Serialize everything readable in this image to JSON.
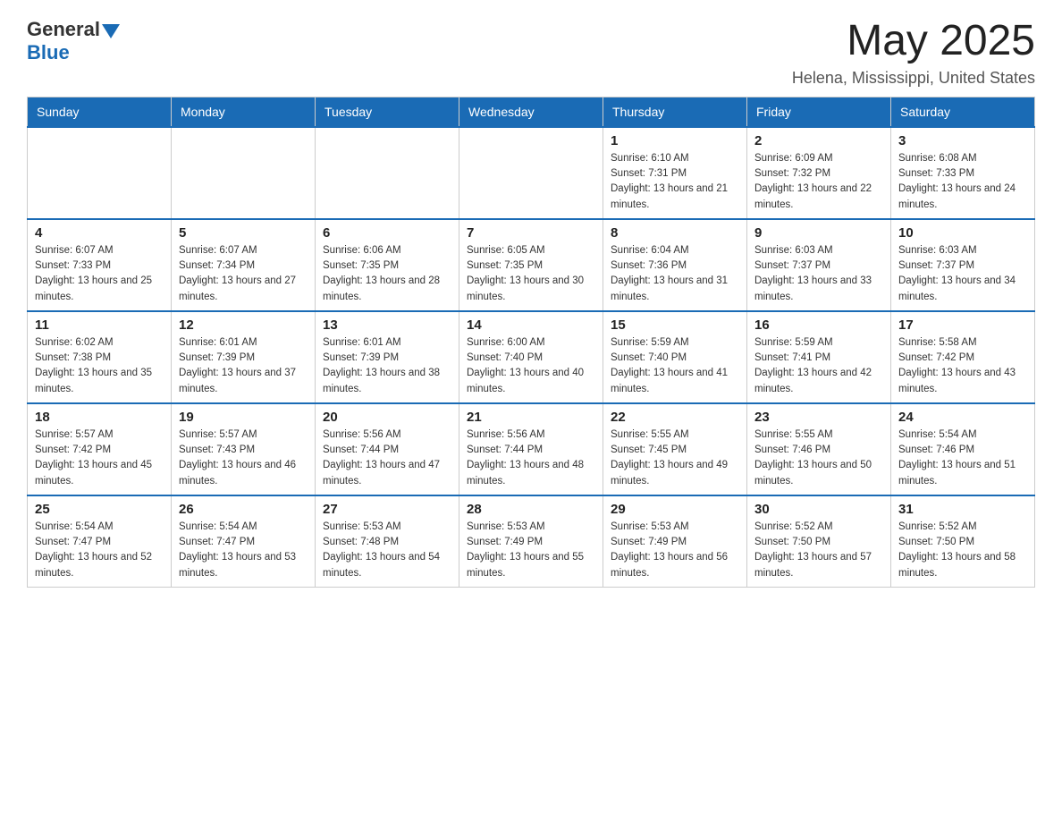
{
  "header": {
    "logo_general": "General",
    "logo_blue": "Blue",
    "month_year": "May 2025",
    "location": "Helena, Mississippi, United States"
  },
  "days_of_week": [
    "Sunday",
    "Monday",
    "Tuesday",
    "Wednesday",
    "Thursday",
    "Friday",
    "Saturday"
  ],
  "weeks": [
    [
      {
        "day": "",
        "info": ""
      },
      {
        "day": "",
        "info": ""
      },
      {
        "day": "",
        "info": ""
      },
      {
        "day": "",
        "info": ""
      },
      {
        "day": "1",
        "info": "Sunrise: 6:10 AM\nSunset: 7:31 PM\nDaylight: 13 hours and 21 minutes."
      },
      {
        "day": "2",
        "info": "Sunrise: 6:09 AM\nSunset: 7:32 PM\nDaylight: 13 hours and 22 minutes."
      },
      {
        "day": "3",
        "info": "Sunrise: 6:08 AM\nSunset: 7:33 PM\nDaylight: 13 hours and 24 minutes."
      }
    ],
    [
      {
        "day": "4",
        "info": "Sunrise: 6:07 AM\nSunset: 7:33 PM\nDaylight: 13 hours and 25 minutes."
      },
      {
        "day": "5",
        "info": "Sunrise: 6:07 AM\nSunset: 7:34 PM\nDaylight: 13 hours and 27 minutes."
      },
      {
        "day": "6",
        "info": "Sunrise: 6:06 AM\nSunset: 7:35 PM\nDaylight: 13 hours and 28 minutes."
      },
      {
        "day": "7",
        "info": "Sunrise: 6:05 AM\nSunset: 7:35 PM\nDaylight: 13 hours and 30 minutes."
      },
      {
        "day": "8",
        "info": "Sunrise: 6:04 AM\nSunset: 7:36 PM\nDaylight: 13 hours and 31 minutes."
      },
      {
        "day": "9",
        "info": "Sunrise: 6:03 AM\nSunset: 7:37 PM\nDaylight: 13 hours and 33 minutes."
      },
      {
        "day": "10",
        "info": "Sunrise: 6:03 AM\nSunset: 7:37 PM\nDaylight: 13 hours and 34 minutes."
      }
    ],
    [
      {
        "day": "11",
        "info": "Sunrise: 6:02 AM\nSunset: 7:38 PM\nDaylight: 13 hours and 35 minutes."
      },
      {
        "day": "12",
        "info": "Sunrise: 6:01 AM\nSunset: 7:39 PM\nDaylight: 13 hours and 37 minutes."
      },
      {
        "day": "13",
        "info": "Sunrise: 6:01 AM\nSunset: 7:39 PM\nDaylight: 13 hours and 38 minutes."
      },
      {
        "day": "14",
        "info": "Sunrise: 6:00 AM\nSunset: 7:40 PM\nDaylight: 13 hours and 40 minutes."
      },
      {
        "day": "15",
        "info": "Sunrise: 5:59 AM\nSunset: 7:40 PM\nDaylight: 13 hours and 41 minutes."
      },
      {
        "day": "16",
        "info": "Sunrise: 5:59 AM\nSunset: 7:41 PM\nDaylight: 13 hours and 42 minutes."
      },
      {
        "day": "17",
        "info": "Sunrise: 5:58 AM\nSunset: 7:42 PM\nDaylight: 13 hours and 43 minutes."
      }
    ],
    [
      {
        "day": "18",
        "info": "Sunrise: 5:57 AM\nSunset: 7:42 PM\nDaylight: 13 hours and 45 minutes."
      },
      {
        "day": "19",
        "info": "Sunrise: 5:57 AM\nSunset: 7:43 PM\nDaylight: 13 hours and 46 minutes."
      },
      {
        "day": "20",
        "info": "Sunrise: 5:56 AM\nSunset: 7:44 PM\nDaylight: 13 hours and 47 minutes."
      },
      {
        "day": "21",
        "info": "Sunrise: 5:56 AM\nSunset: 7:44 PM\nDaylight: 13 hours and 48 minutes."
      },
      {
        "day": "22",
        "info": "Sunrise: 5:55 AM\nSunset: 7:45 PM\nDaylight: 13 hours and 49 minutes."
      },
      {
        "day": "23",
        "info": "Sunrise: 5:55 AM\nSunset: 7:46 PM\nDaylight: 13 hours and 50 minutes."
      },
      {
        "day": "24",
        "info": "Sunrise: 5:54 AM\nSunset: 7:46 PM\nDaylight: 13 hours and 51 minutes."
      }
    ],
    [
      {
        "day": "25",
        "info": "Sunrise: 5:54 AM\nSunset: 7:47 PM\nDaylight: 13 hours and 52 minutes."
      },
      {
        "day": "26",
        "info": "Sunrise: 5:54 AM\nSunset: 7:47 PM\nDaylight: 13 hours and 53 minutes."
      },
      {
        "day": "27",
        "info": "Sunrise: 5:53 AM\nSunset: 7:48 PM\nDaylight: 13 hours and 54 minutes."
      },
      {
        "day": "28",
        "info": "Sunrise: 5:53 AM\nSunset: 7:49 PM\nDaylight: 13 hours and 55 minutes."
      },
      {
        "day": "29",
        "info": "Sunrise: 5:53 AM\nSunset: 7:49 PM\nDaylight: 13 hours and 56 minutes."
      },
      {
        "day": "30",
        "info": "Sunrise: 5:52 AM\nSunset: 7:50 PM\nDaylight: 13 hours and 57 minutes."
      },
      {
        "day": "31",
        "info": "Sunrise: 5:52 AM\nSunset: 7:50 PM\nDaylight: 13 hours and 58 minutes."
      }
    ]
  ]
}
